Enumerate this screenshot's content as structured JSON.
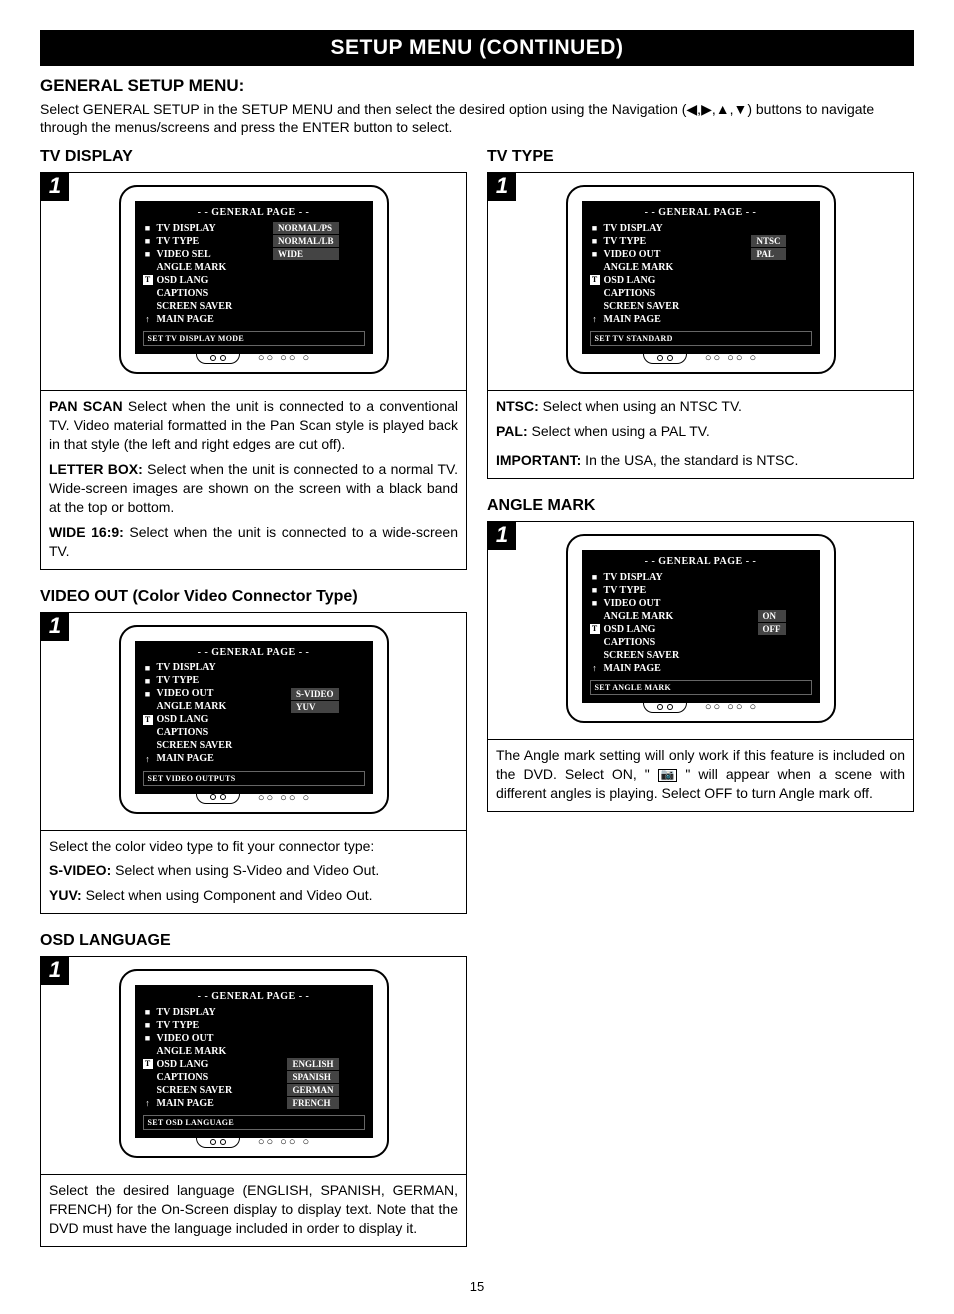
{
  "page_title": "SETUP MENU (CONTINUED)",
  "page_number": "15",
  "intro": {
    "heading": "GENERAL SETUP MENU:",
    "body_prefix": "Select GENERAL SETUP in the SETUP MENU and then select the desired option using the Navigation (",
    "arrows": "◀,▶,▲,▼",
    "body_suffix": ") buttons to navigate through the menus/screens and press the ENTER button to select."
  },
  "sections": {
    "tv_display": {
      "heading": "TV DISPLAY",
      "step": "1",
      "osd": {
        "title": "- - GENERAL PAGE - -",
        "items": [
          {
            "b": "■",
            "label": "TV DISPLAY"
          },
          {
            "b": "■",
            "label": "TV TYPE"
          },
          {
            "b": "■",
            "label": "VIDEO SEL"
          },
          {
            "b": "",
            "label": "ANGLE MARK"
          },
          {
            "b": "T",
            "label": "OSD LANG"
          },
          {
            "b": "",
            "label": "CAPTIONS"
          },
          {
            "b": "",
            "label": "SCREEN SAVER"
          },
          {
            "b": "↑",
            "label": "MAIN PAGE"
          }
        ],
        "options_row": 0,
        "options": [
          "NORMAL/PS",
          "NORMAL/LB",
          "WIDE"
        ],
        "status": "SET TV DISPLAY MODE"
      },
      "desc": {
        "p1_b": "PAN SCAN",
        "p1": " Select when the unit is connected to a conventional TV. Video material formatted in the Pan Scan style is played back in that style (the left and right edges are cut off).",
        "p2_b": "LETTER BOX:",
        "p2": " Select when the unit is connected to a normal TV. Wide-screen images are shown on the screen with a black band at the top or bottom.",
        "p3_b": "WIDE 16:9:",
        "p3": " Select when the unit is connected to a wide-screen TV."
      }
    },
    "tv_type": {
      "heading": "TV TYPE",
      "step": "1",
      "osd": {
        "title": "- - GENERAL PAGE - -",
        "items": [
          {
            "b": "■",
            "label": "TV DISPLAY"
          },
          {
            "b": "■",
            "label": "TV TYPE"
          },
          {
            "b": "■",
            "label": "VIDEO OUT"
          },
          {
            "b": "",
            "label": "ANGLE MARK"
          },
          {
            "b": "T",
            "label": "OSD LANG"
          },
          {
            "b": "",
            "label": "CAPTIONS"
          },
          {
            "b": "",
            "label": "SCREEN SAVER"
          },
          {
            "b": "↑",
            "label": "MAIN PAGE"
          }
        ],
        "options_row": 1,
        "options": [
          "NTSC",
          "PAL"
        ],
        "status": "SET TV STANDARD"
      },
      "desc": {
        "p1_b": "NTSC:",
        "p1": " Select when using an NTSC TV.",
        "p2_b": "PAL:",
        "p2": " Select when using a PAL TV.",
        "p3_b": "IMPORTANT:",
        "p3": " In the USA, the standard is NTSC."
      }
    },
    "video_out": {
      "heading": "VIDEO OUT (Color Video Connector Type)",
      "step": "1",
      "osd": {
        "title": "- - GENERAL PAGE - -",
        "items": [
          {
            "b": "■",
            "label": "TV DISPLAY"
          },
          {
            "b": "■",
            "label": "TV TYPE"
          },
          {
            "b": "■",
            "label": "VIDEO OUT"
          },
          {
            "b": "",
            "label": "ANGLE MARK"
          },
          {
            "b": "T",
            "label": "OSD LANG"
          },
          {
            "b": "",
            "label": "CAPTIONS"
          },
          {
            "b": "",
            "label": "SCREEN SAVER"
          },
          {
            "b": "↑",
            "label": "MAIN PAGE"
          }
        ],
        "options_row": 2,
        "options": [
          "S-VIDEO",
          "YUV"
        ],
        "status": "SET VIDEO OUTPUTS"
      },
      "desc": {
        "p0": "Select the color video type to fit your connector type:",
        "p1_b": "S-VIDEO:",
        "p1": "  Select when using S-Video and Video Out.",
        "p2_b": "YUV:",
        "p2": " Select when using Component and Video Out."
      }
    },
    "angle_mark": {
      "heading": "ANGLE MARK",
      "step": "1",
      "osd": {
        "title": "- - GENERAL PAGE - -",
        "items": [
          {
            "b": "■",
            "label": "TV DISPLAY"
          },
          {
            "b": "■",
            "label": "TV TYPE"
          },
          {
            "b": "■",
            "label": "VIDEO OUT"
          },
          {
            "b": "",
            "label": "ANGLE MARK"
          },
          {
            "b": "T",
            "label": "OSD LANG"
          },
          {
            "b": "",
            "label": "CAPTIONS"
          },
          {
            "b": "",
            "label": "SCREEN SAVER"
          },
          {
            "b": "↑",
            "label": "MAIN PAGE"
          }
        ],
        "options_row": 3,
        "options": [
          "ON",
          "OFF"
        ],
        "status": "SET ANGLE MARK"
      },
      "desc": {
        "p0_a": "The Angle mark setting will only work if this feature is included on the DVD. Select ON,  \" ",
        "p0_b": " \" will appear when a scene with different angles is playing. Select OFF to turn Angle mark off."
      }
    },
    "osd_lang": {
      "heading": "OSD LANGUAGE",
      "step": "1",
      "osd": {
        "title": "- - GENERAL PAGE - -",
        "items": [
          {
            "b": "■",
            "label": "TV DISPLAY"
          },
          {
            "b": "■",
            "label": "TV TYPE"
          },
          {
            "b": "■",
            "label": "VIDEO OUT"
          },
          {
            "b": "",
            "label": "ANGLE MARK"
          },
          {
            "b": "T",
            "label": "OSD LANG"
          },
          {
            "b": "",
            "label": "CAPTIONS"
          },
          {
            "b": "",
            "label": "SCREEN SAVER"
          },
          {
            "b": "↑",
            "label": "MAIN PAGE"
          }
        ],
        "options_row": 4,
        "options": [
          "ENGLISH",
          "SPANISH",
          "GERMAN",
          "FRENCH"
        ],
        "status": "SET OSD LANGUAGE"
      },
      "desc": {
        "p0": "Select the desired language (ENGLISH, SPANISH, GERMAN, FRENCH) for the On-Screen display to display text. Note that the DVD must have the language included in order to display it."
      }
    }
  }
}
